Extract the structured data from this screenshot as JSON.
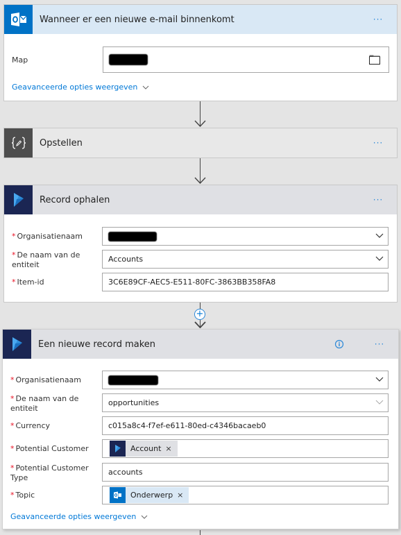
{
  "colors": {
    "background": "#e4e4e4",
    "outlook_blue": "#0072c6",
    "outlook_header": "#d9e8f5",
    "compose_icon": "#4e4e4e",
    "compose_header": "#e8e8e8",
    "dynamics_icon": "#1b2653",
    "dynamics_header": "#dfe0e4",
    "link_blue": "#0078d7",
    "required_red": "#e81123"
  },
  "cards": [
    {
      "id": "trigger",
      "title": "Wanneer er een nieuwe e-mail binnenkomt",
      "icon": "outlook-icon",
      "more_label": "···",
      "fields": [
        {
          "label": "Map",
          "required": false,
          "value": "[redacted]",
          "type": "folder-picker"
        }
      ],
      "advanced_link": "Geavanceerde opties weergeven"
    },
    {
      "id": "compose",
      "title": "Opstellen",
      "icon": "compose-icon",
      "more_label": "···"
    },
    {
      "id": "get-record",
      "title": "Record ophalen",
      "icon": "dynamics-icon",
      "more_label": "···",
      "fields": [
        {
          "label": "Organisatienaam",
          "required": true,
          "value": "[redacted]",
          "type": "dropdown"
        },
        {
          "label": "De naam van de entiteit",
          "required": true,
          "value": "Accounts",
          "type": "dropdown"
        },
        {
          "label": "Item-id",
          "required": true,
          "value": "3C6E89CF-AEC5-E511-80FC-3863BB358FA8",
          "type": "text"
        }
      ]
    },
    {
      "id": "create-record",
      "title": "Een nieuwe record maken",
      "icon": "dynamics-icon",
      "more_label": "···",
      "fields": [
        {
          "label": "Organisatienaam",
          "required": true,
          "value": "[redacted]",
          "type": "dropdown"
        },
        {
          "label": "De naam van de entiteit",
          "required": true,
          "value": "opportunities",
          "type": "dropdown"
        },
        {
          "label": "Currency",
          "required": true,
          "value": "c015a8c4-f7ef-e611-80ed-c4346bacaeb0",
          "type": "text"
        },
        {
          "label": "Potential Customer",
          "required": true,
          "type": "token",
          "token": {
            "label": "Account",
            "icon": "dynamics-icon"
          }
        },
        {
          "label": "Potential Customer Type",
          "required": true,
          "value": "accounts",
          "type": "text"
        },
        {
          "label": "Topic",
          "required": true,
          "type": "token",
          "token": {
            "label": "Onderwerp",
            "icon": "outlook-icon"
          }
        }
      ],
      "advanced_link": "Geavanceerde opties weergeven"
    }
  ],
  "required_marker": "*",
  "token_remove": "×",
  "add_step": "+"
}
